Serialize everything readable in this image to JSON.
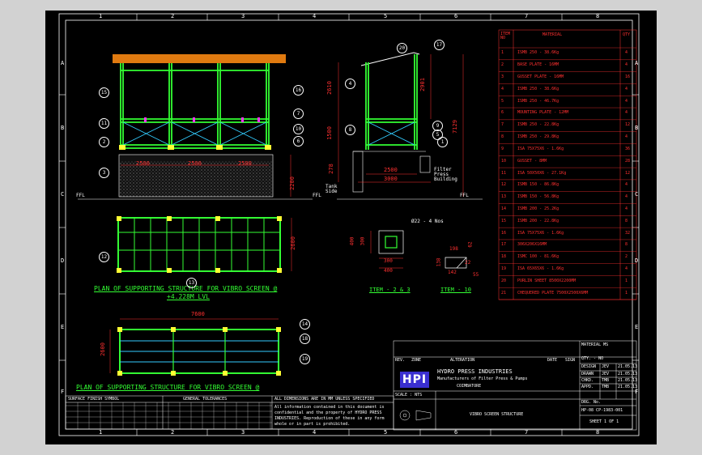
{
  "drawing": {
    "col_numbers": [
      "1",
      "2",
      "3",
      "4",
      "5",
      "6",
      "7",
      "8"
    ],
    "row_letters": [
      "A",
      "B",
      "C",
      "D",
      "E",
      "F"
    ],
    "labels": {
      "plan1_title": "PLAN OF SUPPORTING STRUCTURE FOR VIBRO SCREEN @",
      "plan1_level": "+4.228M LVL",
      "plan2_title": "PLAN OF SUPPORTING STRUCTURE FOR VIBRO SCREEN @",
      "item23": "ITEM - 2 & 3",
      "item10": "ITEM - 10",
      "bolt_note": "Ø22 - 4 Nos",
      "tank_side": "Tank Side",
      "filter_press": "Filter Press Building",
      "ffl_left": "FFL",
      "ffl_mid": "FFL",
      "ffl_right": "FFL"
    },
    "dims": {
      "d2500a": "2500",
      "d2500b": "2500",
      "d2500c": "2500",
      "d2200": "2200",
      "d2610": "2610",
      "d2901": "2901",
      "d1500": "1500",
      "d278": "278",
      "d7129": "7129",
      "d2500_side": "2500",
      "d3000": "3000",
      "d2600_plan": "2600",
      "d7600": "7600",
      "d2600_plan2": "2600",
      "d400_h": "400",
      "d300_h": "300",
      "d300_w": "300",
      "d400_w": "400",
      "d198": "198",
      "d62": "62",
      "d138": "138",
      "d22": "22",
      "d142": "142",
      "d55": "55"
    },
    "callouts": [
      "15",
      "16",
      "11",
      "7",
      "10",
      "2",
      "6",
      "3",
      "20",
      "17",
      "4",
      "8",
      "5",
      "1",
      "12",
      "13",
      "14",
      "18",
      "19",
      "9"
    ]
  },
  "bom": {
    "headers": [
      "ITEM NO",
      "MATERIAL",
      "QTY"
    ],
    "rows": [
      [
        "1",
        "ISMB 250 - 38.6Kg",
        "4"
      ],
      [
        "2",
        "BASE PLATE - 16MM",
        "4"
      ],
      [
        "3",
        "GUSSET PLATE - 16MM",
        "16"
      ],
      [
        "4",
        "ISMB 250 - 38.6Kg",
        "4"
      ],
      [
        "5",
        "ISMB 250 - 46.7Kg",
        "4"
      ],
      [
        "6",
        "MOUNTING PLATE - 12MM",
        "4"
      ],
      [
        "7",
        "ISMB 250 - 22.8Kg",
        "12"
      ],
      [
        "8",
        "ISMB 250 - 29.8Kg",
        "4"
      ],
      [
        "9",
        "ISA 75X75X6 - 1.6Kg",
        "36"
      ],
      [
        "10",
        "GUSSET - 8MM",
        "28"
      ],
      [
        "11",
        "ISA 50X50X6 - 27.1Kg",
        "12"
      ],
      [
        "12",
        "ISMB 150 - 86.8Kg",
        "4"
      ],
      [
        "13",
        "ISMB 150 - 56.8Kg",
        "4"
      ],
      [
        "14",
        "ISMB 200 - 25.2Kg",
        "4"
      ],
      [
        "15",
        "ISMB 200 - 22.8Kg",
        "8"
      ],
      [
        "16",
        "ISA 75X75X6 - 1.6Kg",
        "32"
      ],
      [
        "17",
        "306X206X16MM",
        "8"
      ],
      [
        "18",
        "ISMC 100 - 81.6Kg",
        "2"
      ],
      [
        "19",
        "ISA 65X65X6 - 1.6Kg",
        "4"
      ],
      [
        "20",
        "PURLIN SHEET 8500X2200MM",
        "1"
      ],
      [
        "21",
        "CHEQUERED PLATE 7500X2500X6MM",
        "1"
      ]
    ]
  },
  "title_block": {
    "company": "HYDRO PRESS INDUSTRIES",
    "subtitle": "Manufacturers of Filter Press & Pumps",
    "coimbatore": "COIMBATORE",
    "logo": "HPI",
    "drawing_title": "VIBRO SCREEN STRUCTURE",
    "material": "MATERIAL MS",
    "qty": "QTY. - NO",
    "rev": "REV.",
    "zone": "ZONE",
    "alteration": "ALTERATION",
    "date": "DATE",
    "sign": "SIGN",
    "scale": "SCALE : NTS",
    "design": "DESIGN",
    "drawn": "DRAWN",
    "checked": "CHKD.",
    "approved": "APPD.",
    "dwg_no_label": "DRG. No.",
    "dwg_no": "HP-08 CP-1983-001",
    "sheet": "SHEET 1 OF 1",
    "design_by": "JEV",
    "drawn_by": "JEV",
    "checked_by": "TMB",
    "approved_by": "TMB",
    "date1": "21.05.13",
    "date2": "21.05.13",
    "date3": "21.05.13",
    "date4": "21.05.13",
    "note_left_title": "SURFACE FINISH SYMBOL",
    "note_mid_title": "GENERAL TOLERANCES",
    "note_right_title": "ALL DIMENSIONS ARE IN MM UNLESS SPECIFIED",
    "note_right_body": "All information contained in this document is confidential and the property of HYDRO PRESS INDUSTRIES. Reproduction of these in any form whole or in part is prohibited."
  }
}
